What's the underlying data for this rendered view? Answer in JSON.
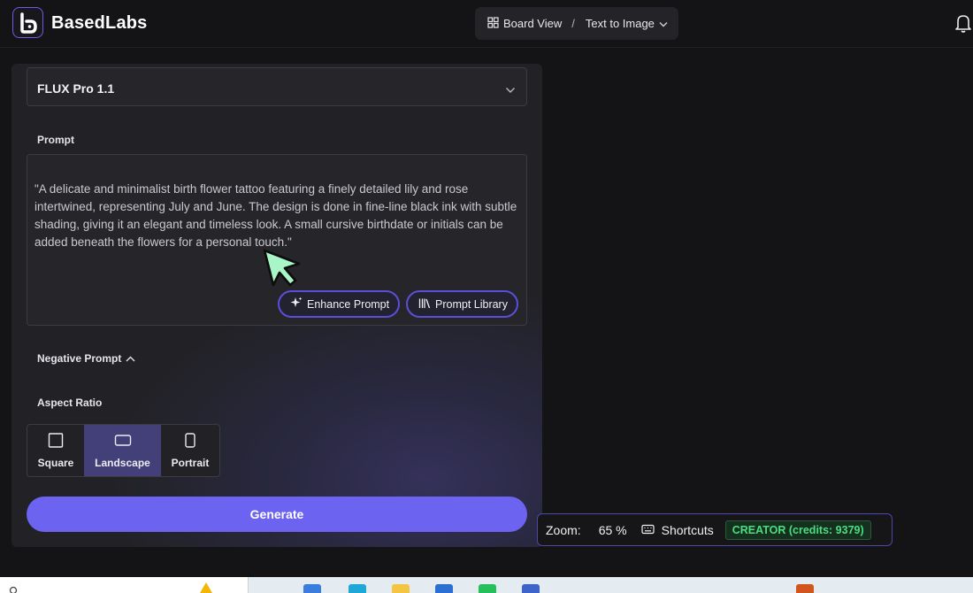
{
  "header": {
    "app_name": "BasedLabs",
    "breadcrumb": {
      "view": "Board View",
      "separator": "/",
      "page": "Text to Image"
    }
  },
  "panel": {
    "model": "FLUX Pro 1.1",
    "prompt_label": "Prompt",
    "prompt_text": "\"A delicate and minimalist birth flower tattoo featuring a finely detailed lily and rose intertwined, representing July and June. The design is done in fine-line black ink with subtle shading, giving it an elegant and timeless look. A small cursive birthdate or initials can be added beneath the flowers for a personal touch.\"",
    "enhance_label": "Enhance Prompt",
    "library_label": "Prompt Library",
    "negative_label": "Negative Prompt",
    "aspect_label": "Aspect Ratio",
    "aspect_options": [
      "Square",
      "Landscape",
      "Portrait"
    ],
    "aspect_selected": "Landscape",
    "generate_label": "Generate"
  },
  "status": {
    "zoom_label": "Zoom:",
    "zoom_value": "65 %",
    "shortcuts_label": "Shortcuts",
    "plan_badge": "CREATOR (credits: 9379)"
  },
  "colors": {
    "accent": "#6c63f0",
    "selected_ratio": "#433f78",
    "credit_green": "#4ade80",
    "cursor_green": "#a8f5c8"
  },
  "icons": [
    "logo-icon",
    "grid-icon",
    "chevron-down-icon",
    "bell-icon",
    "sparkle-icon",
    "library-icon",
    "chevron-up-icon",
    "square-icon",
    "landscape-icon",
    "portrait-icon",
    "keyboard-icon",
    "cursor-icon",
    "search-icon"
  ]
}
